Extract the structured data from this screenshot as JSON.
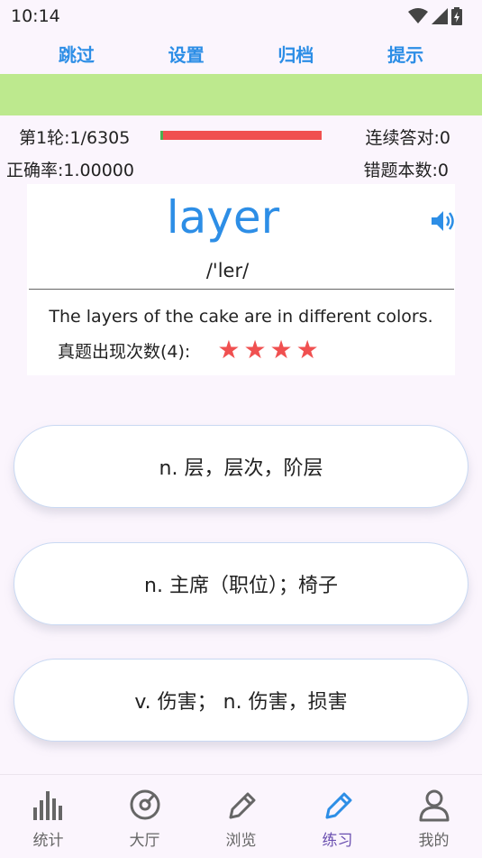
{
  "status_bar": {
    "time": "10:14"
  },
  "top_menu": {
    "skip": "跳过",
    "settings": "设置",
    "archive": "归档",
    "hint": "提示"
  },
  "stats": {
    "round": "第1轮:1/6305",
    "streak": "连续答对:0",
    "accuracy": "正确率:1.00000",
    "wrong_count": "错题本数:0",
    "progress_fraction": 0.00016
  },
  "word_card": {
    "word": "layer",
    "phonetic": "/'ler/",
    "example": "The layers of the cake are in different colors.",
    "exam_frequency_label": "真题出现次数(4):",
    "stars": 4,
    "star_color": "#f05050"
  },
  "options": [
    "n. 层，层次，阶层",
    "n. 主席（职位）；椅子",
    "v. 伤害；  n. 伤害，损害"
  ],
  "bottom_nav": {
    "items": [
      {
        "label": "统计",
        "icon": "bar-chart-icon"
      },
      {
        "label": "大厅",
        "icon": "disc-icon"
      },
      {
        "label": "浏览",
        "icon": "pencil-icon"
      },
      {
        "label": "练习",
        "icon": "pencil-icon-active"
      },
      {
        "label": "我的",
        "icon": "user-icon"
      }
    ],
    "active_index": 3
  },
  "colors": {
    "accent": "#2d8ee6",
    "green_band": "#bde98e",
    "active_nav": "#6a4fb0"
  }
}
